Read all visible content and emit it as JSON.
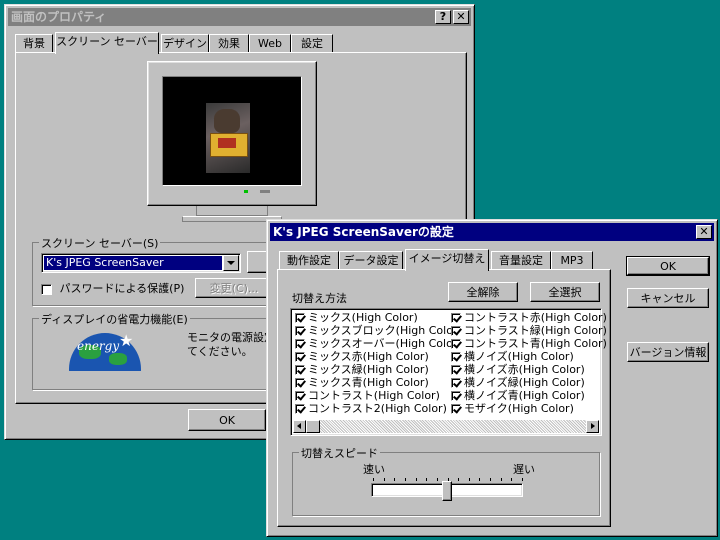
{
  "props": {
    "title": "画面のプロパティ",
    "help_button": "?",
    "close_button": "✕",
    "tabs": [
      "背景",
      "スクリーン セーバー",
      "デザイン",
      "効果",
      "Web",
      "設定"
    ],
    "screensaver_group_label": "スクリーン セーバー(S)",
    "screensaver_selected": "K's JPEG ScreenSaver",
    "password_label": "パスワードによる保護(P)",
    "change_button": "変更(C)...",
    "energy_group_label": "ディスプレイの省電力機能(E)",
    "energy_text_1": "モニタの電源設定",
    "energy_text_2": "てください。",
    "energy_logo_text": "energy",
    "ok_button": "OK"
  },
  "settings": {
    "title": "K's JPEG ScreenSaverの設定",
    "close_button": "✕",
    "tabs": [
      "動作設定",
      "データ設定",
      "イメージ切替え",
      "音量設定",
      "MP3"
    ],
    "switch_method_label": "切替え方法",
    "clear_all_button": "全解除",
    "select_all_button": "全選択",
    "effects_left": [
      "ミックス(High Color)",
      "ミックスブロック(High Color)",
      "ミックスオーバー(High Color)",
      "ミックス赤(High Color)",
      "ミックス緑(High Color)",
      "ミックス青(High Color)",
      "コントラスト(High Color)",
      "コントラスト2(High Color)"
    ],
    "effects_right": [
      "コントラスト赤(High Color)",
      "コントラスト緑(High Color)",
      "コントラスト青(High Color)",
      "横ノイズ(High Color)",
      "横ノイズ赤(High Color)",
      "横ノイズ緑(High Color)",
      "横ノイズ青(High Color)",
      "モザイク(High Color)"
    ],
    "speed_group_label": "切替えスピード",
    "speed_slow": "速い",
    "speed_fast": "遅い",
    "speed_value": 0.5,
    "ok_button": "OK",
    "cancel_button": "キャンセル",
    "version_button": "バージョン情報"
  },
  "colors": {
    "desktop": "#008080",
    "active_title": "#000080",
    "inactive_title": "#808080",
    "face": "#c0c0c0"
  }
}
